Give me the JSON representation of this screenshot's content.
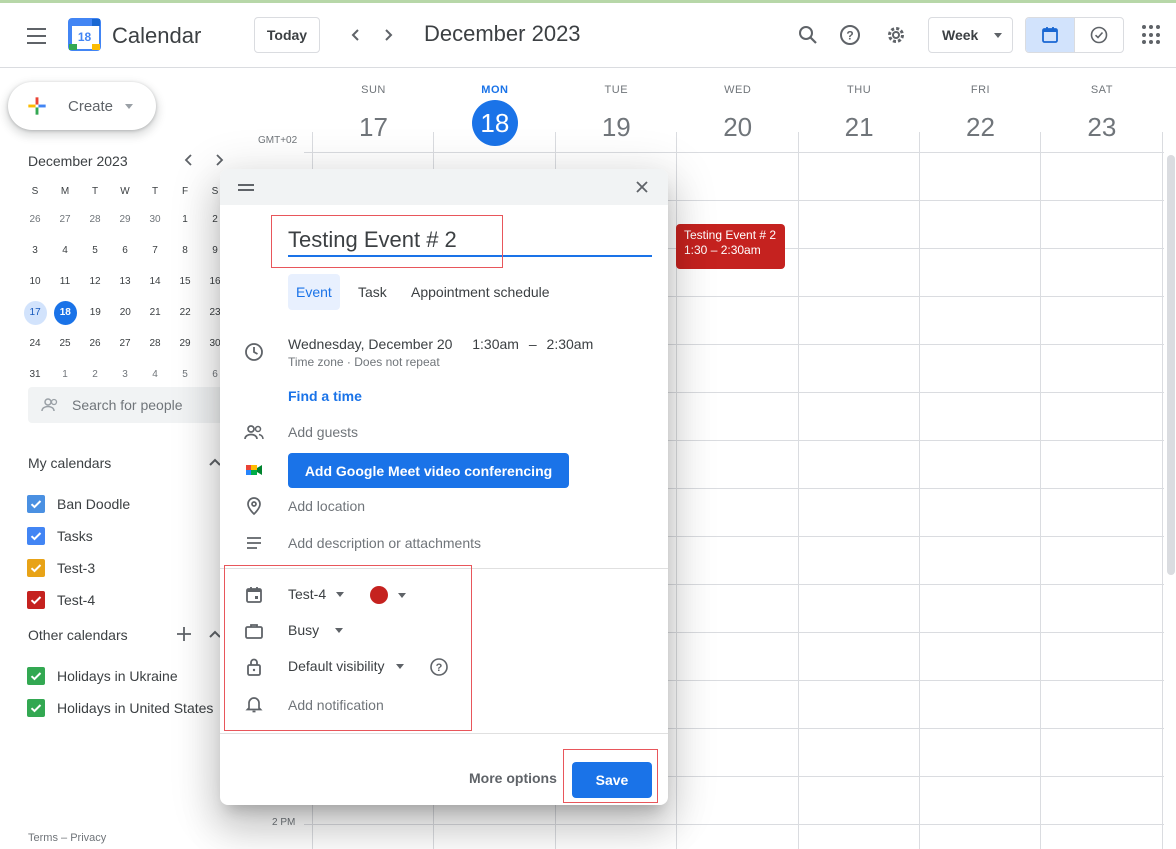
{
  "header": {
    "app_title": "Calendar",
    "logo_number": "18",
    "today_label": "Today",
    "prev_icon": "chevron-left-icon",
    "next_icon": "chevron-right-icon",
    "month_title": "December 2023",
    "view_select": "Week",
    "icons": [
      "menu-icon",
      "search-icon",
      "help-icon",
      "settings-icon",
      "calendar-view-icon",
      "tasks-view-icon",
      "apps-icon"
    ]
  },
  "sidebar": {
    "create_label": "Create",
    "mini_calendar": {
      "title": "December 2023",
      "weekdays": [
        "S",
        "M",
        "T",
        "W",
        "T",
        "F",
        "S"
      ],
      "weeks": [
        [
          "26",
          "27",
          "28",
          "29",
          "30",
          "1",
          "2"
        ],
        [
          "3",
          "4",
          "5",
          "6",
          "7",
          "8",
          "9"
        ],
        [
          "10",
          "11",
          "12",
          "13",
          "14",
          "15",
          "16"
        ],
        [
          "17",
          "18",
          "19",
          "20",
          "21",
          "22",
          "23"
        ],
        [
          "24",
          "25",
          "26",
          "27",
          "28",
          "29",
          "30"
        ],
        [
          "31",
          "1",
          "2",
          "3",
          "4",
          "5",
          "6"
        ]
      ],
      "selected": "17",
      "today": "18"
    },
    "search_people_placeholder": "Search for people",
    "my_calendars_title": "My calendars",
    "my_calendars": [
      {
        "name": "Ban Doodle",
        "color": "#4a90e2"
      },
      {
        "name": "Tasks",
        "color": "#4285f4"
      },
      {
        "name": "Test-3",
        "color": "#e8a317"
      },
      {
        "name": "Test-4",
        "color": "#c5221f"
      }
    ],
    "other_calendars_title": "Other calendars",
    "other_calendars": [
      {
        "name": "Holidays in Ukraine",
        "color": "#33a852"
      },
      {
        "name": "Holidays in United States",
        "color": "#33a852"
      }
    ],
    "footer": {
      "terms": "Terms",
      "sep": "–",
      "privacy": "Privacy"
    }
  },
  "week": {
    "timezone": "GMT+02",
    "days": [
      {
        "name": "SUN",
        "num": "17"
      },
      {
        "name": "MON",
        "num": "18"
      },
      {
        "name": "TUE",
        "num": "19"
      },
      {
        "name": "WED",
        "num": "20"
      },
      {
        "name": "THU",
        "num": "21"
      },
      {
        "name": "FRI",
        "num": "22"
      },
      {
        "name": "SAT",
        "num": "23"
      }
    ],
    "today_index": 1,
    "time_label_2pm": "2 PM",
    "event": {
      "title": "Testing Event # 2",
      "time": "1:30 – 2:30am",
      "color": "#c5221f"
    }
  },
  "dialog": {
    "title_value": "Testing Event # 2",
    "tabs": [
      "Event",
      "Task",
      "Appointment schedule"
    ],
    "active_tab": "Event",
    "date": "Wednesday, December 20",
    "start_time": "1:30am",
    "dash": "–",
    "end_time": "2:30am",
    "timezone_link": "Time zone",
    "dot": "·",
    "repeat": "Does not repeat",
    "find_time": "Find a time",
    "add_guests": "Add guests",
    "meet_button": "Add Google Meet video conferencing",
    "add_location": "Add location",
    "add_description": "Add description or attachments",
    "calendar_value": "Test-4",
    "event_color": "#c5221f",
    "busy_value": "Busy",
    "visibility_value": "Default visibility",
    "add_notification": "Add notification",
    "more_options": "More options",
    "save": "Save"
  },
  "colors": {
    "accent": "#1a73e8",
    "event_red": "#c5221f",
    "highlight_box": "#e8565b"
  }
}
